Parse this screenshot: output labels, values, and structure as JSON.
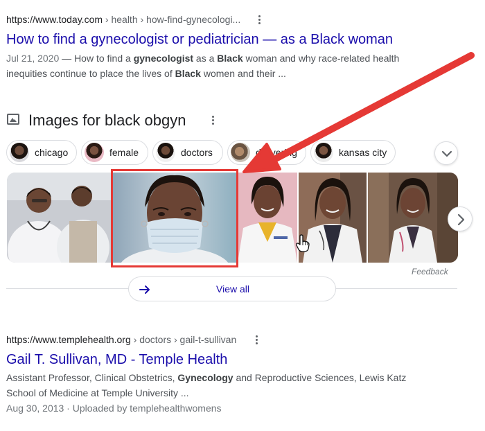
{
  "result1": {
    "url": "https://www.today.com",
    "crumbs": " › health › how-find-gynecologi...",
    "title": "How to find a gynecologist or pediatrician — as a Black woman",
    "date": "Jul 21, 2020",
    "snippet_line1": [
      {
        "t": " — How to find a ",
        "b": false
      },
      {
        "t": "gynecologist",
        "b": true
      },
      {
        "t": " as a ",
        "b": false
      },
      {
        "t": "Black",
        "b": true
      },
      {
        "t": " woman and why race-related health",
        "b": false
      }
    ],
    "snippet_line2": [
      {
        "t": "inequities continue to place the lives of ",
        "b": false
      },
      {
        "t": "Black",
        "b": true
      },
      {
        "t": " women and their ...",
        "b": false
      }
    ]
  },
  "images": {
    "title": "Images for black obgyn",
    "chips": [
      {
        "label": "chicago"
      },
      {
        "label": "female"
      },
      {
        "label": "doctors"
      },
      {
        "label": "delivering"
      },
      {
        "label": "kansas city"
      }
    ],
    "feedback": "Feedback",
    "view_all": "View all"
  },
  "result2": {
    "url": "https://www.templehealth.org",
    "crumbs": " › doctors › gail-t-sullivan",
    "title": "Gail T. Sullivan, MD - Temple Health",
    "snippet_line1": [
      {
        "t": "Assistant Professor, Clinical Obstetrics, ",
        "b": false
      },
      {
        "t": "Gynecology",
        "b": true
      },
      {
        "t": " and Reproductive Sciences, Lewis Katz",
        "b": false
      }
    ],
    "snippet_line2": "School of Medicine at Temple University ...",
    "meta": "Aug 30, 2013 · Uploaded by templehealthwomens"
  },
  "colors": {
    "link": "#1a0dab",
    "annotation_red": "#e53935"
  }
}
